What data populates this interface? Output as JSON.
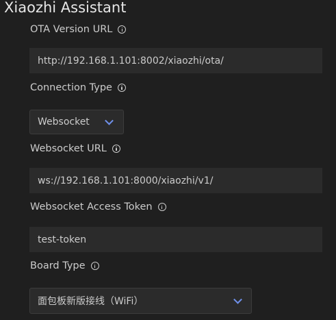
{
  "app": {
    "title": "Xiaozhi Assistant"
  },
  "form": {
    "ota_url": {
      "label": "OTA Version URL",
      "value": "http://192.168.1.101:8002/xiaozhi/ota/"
    },
    "connection_type": {
      "label": "Connection Type",
      "value": "Websocket"
    },
    "websocket_url": {
      "label": "Websocket URL",
      "value": "ws://192.168.1.101:8000/xiaozhi/v1/"
    },
    "access_token": {
      "label": "Websocket Access Token",
      "value": "test-token"
    },
    "board_type": {
      "label": "Board Type",
      "value": "面包板新版接线（WiFi）"
    }
  },
  "icons": {
    "info": "info-icon",
    "dropdown": "chevron-down-icon"
  },
  "colors": {
    "background": "#1f1f1f",
    "input_background": "#2b2b2b",
    "text": "#cccccc",
    "accent": "#6f8fe8"
  }
}
